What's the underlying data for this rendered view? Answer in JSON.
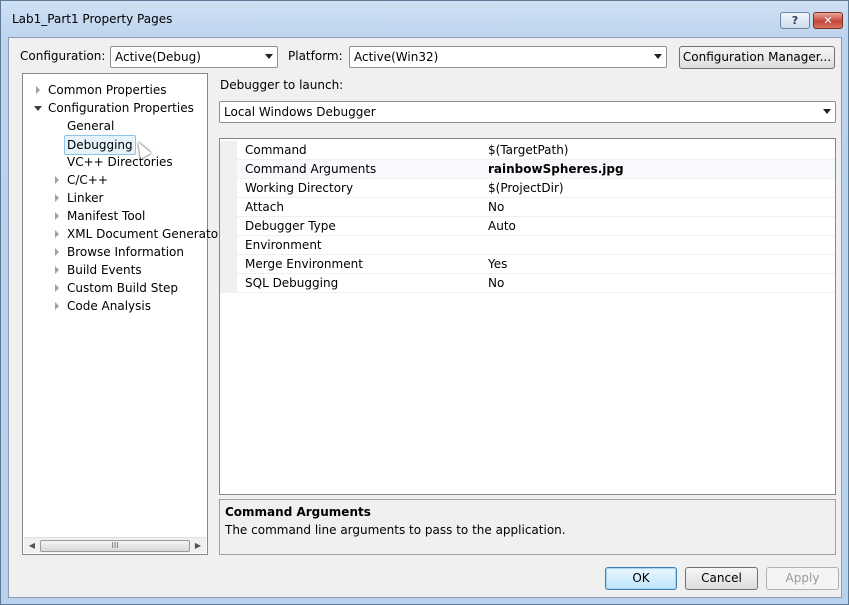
{
  "window": {
    "title": "Lab1_Part1 Property Pages",
    "help_label": "?",
    "close_label": "✕"
  },
  "config": {
    "configuration_label": "Configuration:",
    "configuration_value": "Active(Debug)",
    "platform_label": "Platform:",
    "platform_value": "Active(Win32)",
    "manager_button": "Configuration Manager..."
  },
  "tree": {
    "items": [
      {
        "label": "Common Properties"
      },
      {
        "label": "Configuration Properties"
      },
      {
        "label": "General"
      },
      {
        "label": "Debugging"
      },
      {
        "label": "VC++ Directories"
      },
      {
        "label": "C/C++"
      },
      {
        "label": "Linker"
      },
      {
        "label": "Manifest Tool"
      },
      {
        "label": "XML Document Generator"
      },
      {
        "label": "Browse Information"
      },
      {
        "label": "Build Events"
      },
      {
        "label": "Custom Build Step"
      },
      {
        "label": "Code Analysis"
      }
    ],
    "scroll_grip": "III"
  },
  "debugger": {
    "label": "Debugger to launch:",
    "value": "Local Windows Debugger"
  },
  "properties": [
    {
      "name": "Command",
      "value": "$(TargetPath)"
    },
    {
      "name": "Command Arguments",
      "value": "rainbowSpheres.jpg"
    },
    {
      "name": "Working Directory",
      "value": "$(ProjectDir)"
    },
    {
      "name": "Attach",
      "value": "No"
    },
    {
      "name": "Debugger Type",
      "value": "Auto"
    },
    {
      "name": "Environment",
      "value": ""
    },
    {
      "name": "Merge Environment",
      "value": "Yes"
    },
    {
      "name": "SQL Debugging",
      "value": "No"
    }
  ],
  "description": {
    "title": "Command Arguments",
    "text": "The command line arguments to pass to the application."
  },
  "buttons": {
    "ok": "OK",
    "cancel": "Cancel",
    "apply": "Apply"
  }
}
